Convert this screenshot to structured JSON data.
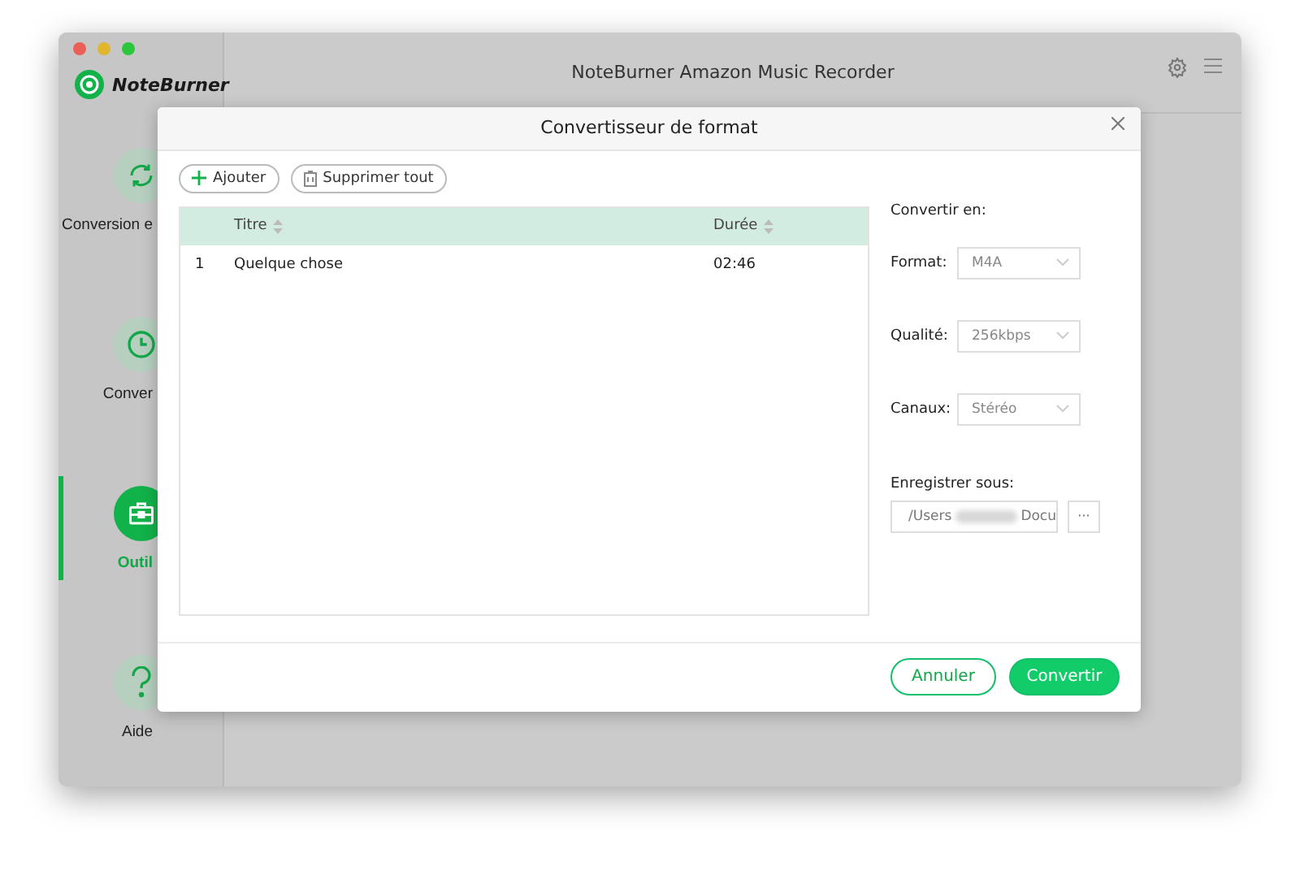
{
  "window": {
    "title": "NoteBurner Amazon Music Recorder",
    "logo": "NoteBurner"
  },
  "sidebar": {
    "items": [
      {
        "kind": "convert",
        "label": "Conversion e",
        "selected": false
      },
      {
        "kind": "history",
        "label": "Conver",
        "selected": false
      },
      {
        "kind": "tools",
        "label": "Outil",
        "selected": true
      },
      {
        "kind": "help",
        "label": "Aide",
        "selected": false
      }
    ]
  },
  "dialog": {
    "title": "Convertisseur de format",
    "toolbar": [
      {
        "kind": "add",
        "label": "Ajouter"
      },
      {
        "kind": "delete",
        "label": "Supprimer tout"
      }
    ],
    "table": {
      "columns": [
        "Titre",
        "Durée"
      ],
      "rows": [
        {
          "index": "1",
          "title": "Quelque chose",
          "duration": "02:46"
        }
      ]
    },
    "settings": {
      "heading": "Convertir en:",
      "fields": [
        {
          "label": "Format:",
          "value": "M4A"
        },
        {
          "label": "Qualité:",
          "value": "256kbps"
        },
        {
          "label": "Canaux:",
          "value": "Stéréo"
        }
      ],
      "save": {
        "label": "Enregistrer sous:",
        "value_start": "/Users",
        "value_end": "Docu",
        "browse": "···"
      }
    },
    "buttons": [
      {
        "kind": "secondary",
        "label": "Annuler"
      },
      {
        "kind": "primary",
        "label": "Convertir"
      }
    ]
  }
}
